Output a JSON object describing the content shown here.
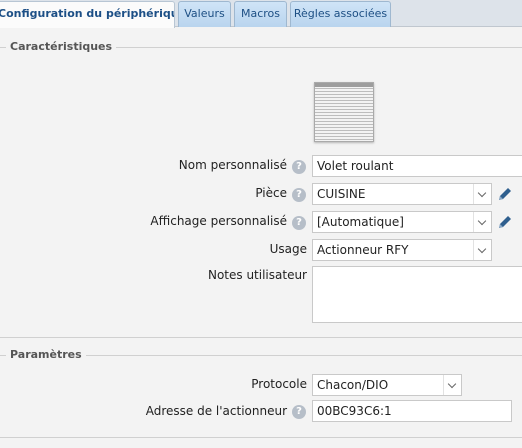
{
  "tabs": [
    {
      "label": "Configuration du périphérique",
      "active": true
    },
    {
      "label": "Valeurs",
      "active": false
    },
    {
      "label": "Macros",
      "active": false
    },
    {
      "label": "Règles associées",
      "active": false
    }
  ],
  "characteristics": {
    "legend": "Caractéristiques",
    "image_icon": "roller-shutter-icon",
    "custom_name": {
      "label": "Nom personnalisé",
      "value": "Volet roulant"
    },
    "room": {
      "label": "Pièce",
      "value": "CUISINE"
    },
    "custom_display": {
      "label": "Affichage personnalisé",
      "value": "[Automatique]"
    },
    "usage": {
      "label": "Usage",
      "value": "Actionneur RFY"
    },
    "notes": {
      "label": "Notes utilisateur",
      "value": ""
    }
  },
  "parameters": {
    "legend": "Paramètres",
    "protocol": {
      "label": "Protocole",
      "value": "Chacon/DIO"
    },
    "actuator_address": {
      "label": "Adresse de l'actionneur",
      "value": "00BC93C6:1"
    }
  },
  "help_glyph": "?",
  "colors": {
    "tab_active_text": "#1c4f86",
    "edit_icon": "#2f5f8e",
    "help_icon": "#b6bec8"
  }
}
